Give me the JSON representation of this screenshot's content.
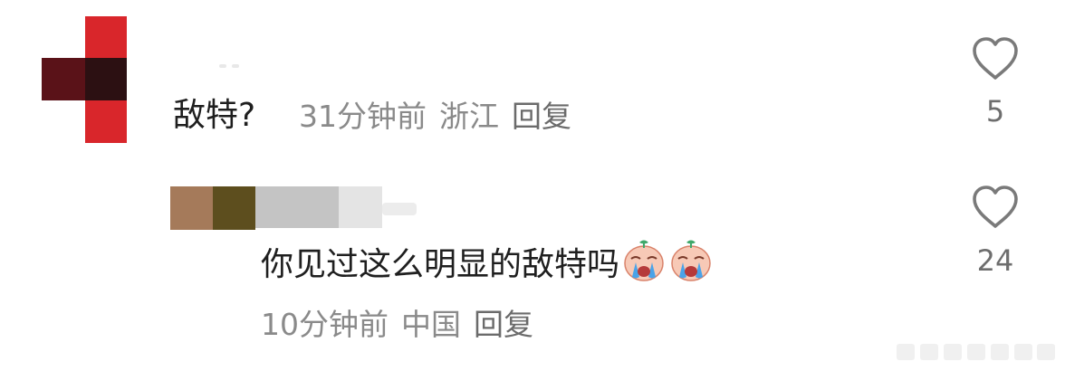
{
  "comments": [
    {
      "text": "敌特?",
      "time": "31分钟前",
      "location": "浙江",
      "reply_label": "回复",
      "likes": "5"
    },
    {
      "text": "你见过这么明显的敌特吗",
      "time": "10分钟前",
      "location": "中国",
      "reply_label": "回复",
      "likes": "24",
      "emojis": [
        "crying-emoji",
        "crying-emoji"
      ]
    }
  ],
  "icons": {
    "like": "heart-outline-icon"
  },
  "colors": {
    "text_primary": "#1f1f1f",
    "text_meta": "#8a8a8a",
    "heart_stroke": "#7a7a7a",
    "avatar_red": "#d9262b",
    "avatar_dark": "#5a1218"
  }
}
